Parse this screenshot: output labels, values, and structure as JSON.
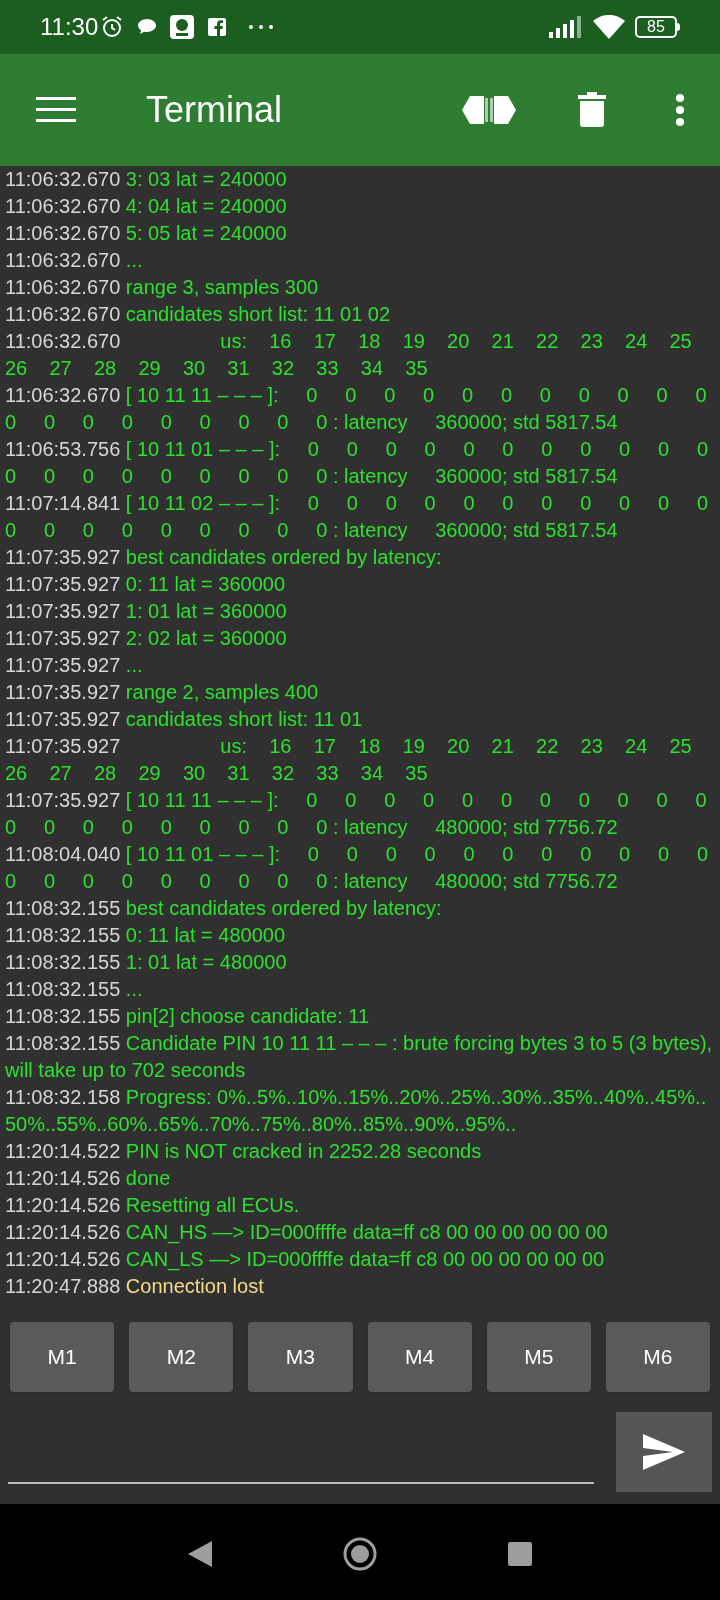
{
  "status_bar": {
    "time": "11:30",
    "battery": "85"
  },
  "toolbar": {
    "title": "Terminal"
  },
  "log": [
    {
      "time": "11:06:32.670",
      "text": "3: 03 lat = 240000",
      "kind": "data"
    },
    {
      "time": "11:06:32.670",
      "text": "4: 04 lat = 240000",
      "kind": "data"
    },
    {
      "time": "11:06:32.670",
      "text": "5: 05 lat = 240000",
      "kind": "data"
    },
    {
      "time": "11:06:32.670",
      "text": "...",
      "kind": "data"
    },
    {
      "time": "11:06:32.670",
      "text": "range 3, samples 300",
      "kind": "data"
    },
    {
      "time": "11:06:32.670",
      "text": "candidates short list: 11 01 02",
      "kind": "data"
    },
    {
      "time": "11:06:32.670",
      "text": "                 us:    16    17    18    19    20    21    22    23    24    25    26    27    28    29    30    31    32    33    34    35",
      "kind": "data"
    },
    {
      "time": "11:06:32.670",
      "text": "[ 10 11 11 – – – ]:     0     0     0     0     0     0     0     0     0     0     0  0     0     0     0     0     0     0     0     0 : latency     360000; std 5817.54",
      "kind": "data"
    },
    {
      "time": "11:06:53.756",
      "text": "[ 10 11 01 – – – ]:     0     0     0     0     0     0     0     0     0     0     0  0     0     0     0     0     0     0     0     0 : latency     360000; std 5817.54",
      "kind": "data"
    },
    {
      "time": "11:07:14.841",
      "text": "[ 10 11 02 – – – ]:     0     0     0     0     0     0     0     0     0     0     0  0     0     0     0     0     0     0     0     0 : latency     360000; std 5817.54",
      "kind": "data"
    },
    {
      "time": "11:07:35.927",
      "text": "best candidates ordered by latency:",
      "kind": "data"
    },
    {
      "time": "11:07:35.927",
      "text": "0: 11 lat = 360000",
      "kind": "data"
    },
    {
      "time": "11:07:35.927",
      "text": "1: 01 lat = 360000",
      "kind": "data"
    },
    {
      "time": "11:07:35.927",
      "text": "2: 02 lat = 360000",
      "kind": "data"
    },
    {
      "time": "11:07:35.927",
      "text": "...",
      "kind": "data"
    },
    {
      "time": "11:07:35.927",
      "text": "range 2, samples 400",
      "kind": "data"
    },
    {
      "time": "11:07:35.927",
      "text": "candidates short list: 11 01",
      "kind": "data"
    },
    {
      "time": "11:07:35.927",
      "text": "                 us:    16    17    18    19    20    21    22    23    24    25    26    27    28    29    30    31    32    33    34    35",
      "kind": "data"
    },
    {
      "time": "11:07:35.927",
      "text": "[ 10 11 11 – – – ]:     0     0     0     0     0     0     0     0     0     0     0  0     0     0     0     0     0     0     0     0 : latency     480000; std 7756.72",
      "kind": "data"
    },
    {
      "time": "11:08:04.040",
      "text": "[ 10 11 01 – – – ]:     0     0     0     0     0     0     0     0     0     0     0  0     0     0     0     0     0     0     0     0 : latency     480000; std 7756.72",
      "kind": "data"
    },
    {
      "time": "11:08:32.155",
      "text": "best candidates ordered by latency:",
      "kind": "data"
    },
    {
      "time": "11:08:32.155",
      "text": "0: 11 lat = 480000",
      "kind": "data"
    },
    {
      "time": "11:08:32.155",
      "text": "1: 01 lat = 480000",
      "kind": "data"
    },
    {
      "time": "11:08:32.155",
      "text": "...",
      "kind": "data"
    },
    {
      "time": "11:08:32.155",
      "text": "pin[2] choose candidate: 11",
      "kind": "data"
    },
    {
      "time": "11:08:32.155",
      "text": "Candidate PIN 10 11 11 – – – : brute forcing bytes 3 to 5 (3 bytes), will take up to 702 seconds",
      "kind": "data"
    },
    {
      "time": "11:08:32.158",
      "text": "Progress: 0%..5%..10%..15%..20%..25%..30%..35%..40%..45%..50%..55%..60%..65%..70%..75%..80%..85%..90%..95%..",
      "kind": "data"
    },
    {
      "time": "11:20:14.522",
      "text": "PIN is NOT cracked in 2252.28 seconds",
      "kind": "data"
    },
    {
      "time": "11:20:14.526",
      "text": "done",
      "kind": "data"
    },
    {
      "time": "11:20:14.526",
      "text": "Resetting all ECUs.",
      "kind": "data"
    },
    {
      "time": "11:20:14.526",
      "text": "CAN_HS —> ID=000ffffe data=ff c8 00 00 00 00 00 00",
      "kind": "data"
    },
    {
      "time": "11:20:14.526",
      "text": "CAN_LS —> ID=000ffffe data=ff c8 00 00 00 00 00 00",
      "kind": "data"
    },
    {
      "time": "11:20:47.888",
      "text": "Connection lost",
      "kind": "status"
    }
  ],
  "macro_buttons": [
    "M1",
    "M2",
    "M3",
    "M4",
    "M5",
    "M6"
  ]
}
